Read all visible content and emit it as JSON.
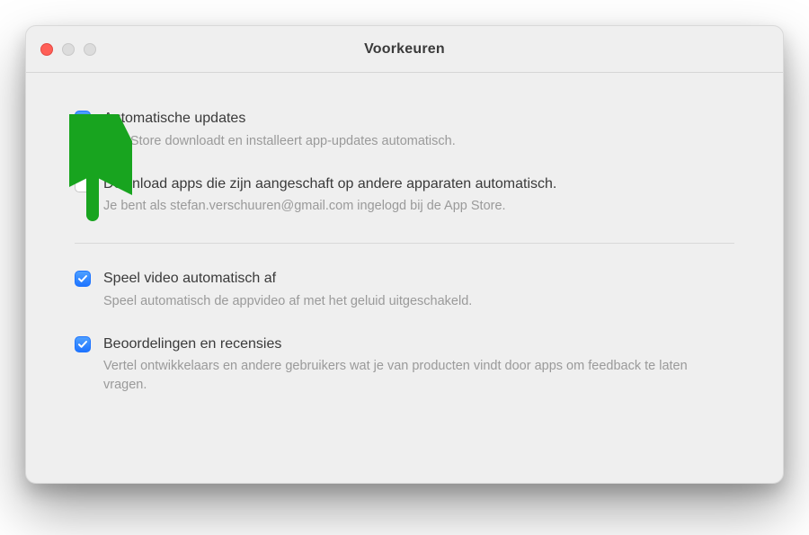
{
  "window": {
    "title": "Voorkeuren"
  },
  "prefs": [
    {
      "checked": true,
      "label": "Automatische updates",
      "desc": "App Store downloadt en installeert app-updates automatisch."
    },
    {
      "checked": false,
      "label": "Download apps die zijn aangeschaft op andere apparaten automatisch.",
      "desc": "Je bent als stefan.verschuuren@gmail.com ingelogd bij de App Store."
    },
    {
      "checked": true,
      "label": "Speel video automatisch af",
      "desc": "Speel automatisch de appvideo af met het geluid uitgeschakeld."
    },
    {
      "checked": true,
      "label": "Beoordelingen en recensies",
      "desc": "Vertel ontwikkelaars en andere gebruikers wat je van producten vindt door apps om feedback te laten vragen."
    }
  ],
  "annotation": {
    "arrow_color": "#18a41f"
  }
}
